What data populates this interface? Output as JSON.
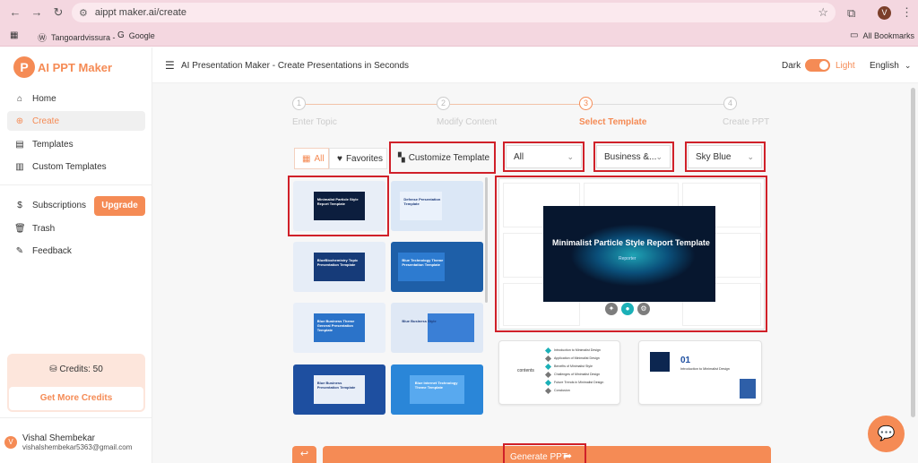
{
  "browser": {
    "url": "aippt maker.ai/create",
    "bookmarks": [
      "Tangoardvissura -",
      "Google"
    ],
    "all_bookmarks": "All Bookmarks",
    "profile_initial": "V"
  },
  "sidebar": {
    "logo_letter": "P",
    "logo_text": "AI PPT Maker",
    "nav": [
      {
        "label": "Home",
        "icon": "home-icon"
      },
      {
        "label": "Create",
        "icon": "plus-circle-icon"
      },
      {
        "label": "Templates",
        "icon": "templates-icon"
      },
      {
        "label": "Custom Templates",
        "icon": "custom-templates-icon"
      }
    ],
    "nav2": [
      {
        "label": "Subscriptions",
        "icon": "dollar-icon"
      },
      {
        "label": "Trash",
        "icon": "trash-icon"
      },
      {
        "label": "Feedback",
        "icon": "feedback-icon"
      }
    ],
    "upgrade_label": "Upgrade",
    "credits_label": "Credits: 50",
    "get_credits_label": "Get More Credits",
    "user_initial": "V",
    "user_name": "Vishal Shembekar",
    "user_email": "vishalshembekar5363@gmail.com"
  },
  "header": {
    "title": "AI Presentation Maker - Create Presentations in Seconds",
    "dark_label": "Dark",
    "light_label": "Light",
    "language": "English"
  },
  "steps": [
    {
      "num": "1",
      "label": "Enter Topic"
    },
    {
      "num": "2",
      "label": "Modify Content"
    },
    {
      "num": "3",
      "label": "Select Template"
    },
    {
      "num": "4",
      "label": "Create PPT"
    }
  ],
  "filters": {
    "all_chip": "All",
    "favorites_chip": "Favorites",
    "customize_label": "Customize Template",
    "dropdown_all": "All",
    "dropdown_category": "Business &...",
    "dropdown_color": "Sky Blue"
  },
  "thumbnails": [
    "Minimalist Particle Style Report Template",
    "Defense Presentation Template",
    "BlueBiochemistry Topic Presentation Template",
    "Blue Technology Theme Presentation Template",
    "Blue Business Theme General Presentation Template",
    "Blue Business Style",
    "Blue Business Presentation Template",
    "Blue Internet Technology Theme Template"
  ],
  "preview": {
    "title": "Minimalist Particle Style Report Template",
    "subtitle": "Reporter",
    "contents_label": "contents",
    "contents_items": [
      "Introduction to Minimalist Design",
      "Application of Minimalist Design",
      "Benefits of Minimalist Style",
      "Challenges of Minimalist Design",
      "Future Trends in Minimalist Design",
      "Conclusion"
    ],
    "section_num": "01",
    "section_title": "Introduction to Minimalist Design"
  },
  "footer": {
    "generate_label": "Generate PPT"
  }
}
